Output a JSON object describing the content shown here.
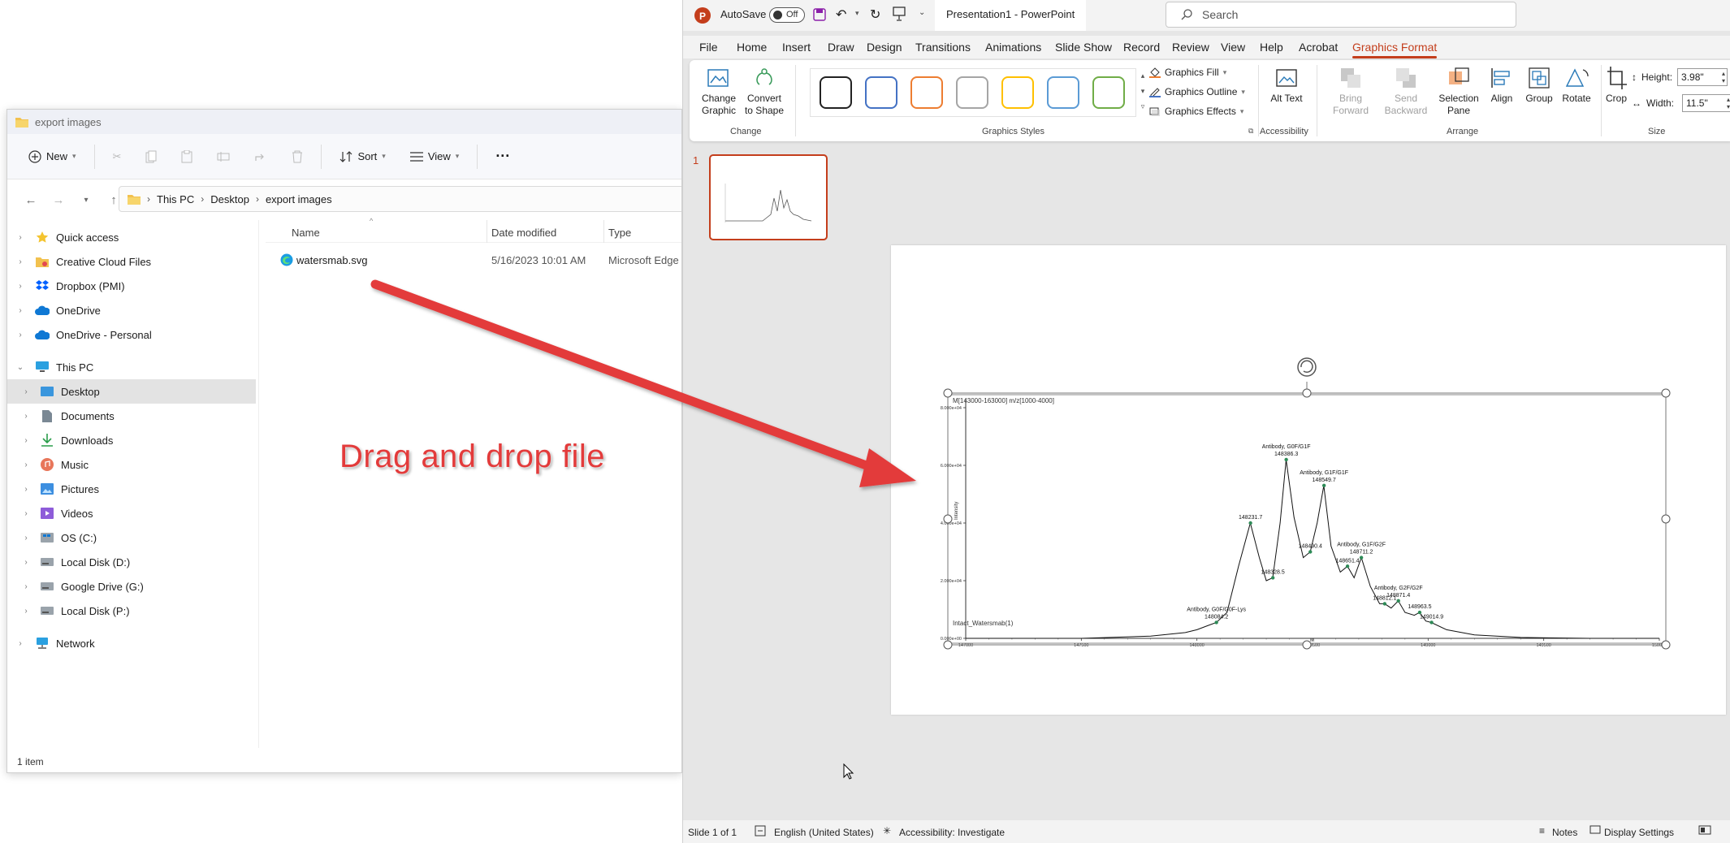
{
  "explorer": {
    "title": "export images",
    "toolbar": {
      "new_label": "New",
      "sort_label": "Sort",
      "view_label": "View",
      "more_label": "···"
    },
    "breadcrumb": [
      "This PC",
      "Desktop",
      "export images"
    ],
    "nav": [
      {
        "label": "Quick access"
      },
      {
        "label": "Creative Cloud Files"
      },
      {
        "label": "Dropbox (PMI)"
      },
      {
        "label": "OneDrive"
      },
      {
        "label": "OneDrive - Personal"
      },
      {
        "label": "This PC"
      },
      {
        "label": "Desktop"
      },
      {
        "label": "Documents"
      },
      {
        "label": "Downloads"
      },
      {
        "label": "Music"
      },
      {
        "label": "Pictures"
      },
      {
        "label": "Videos"
      },
      {
        "label": "OS (C:)"
      },
      {
        "label": "Local Disk (D:)"
      },
      {
        "label": "Google Drive (G:)"
      },
      {
        "label": "Local Disk (P:)"
      },
      {
        "label": "Network"
      }
    ],
    "columns": {
      "name": "Name",
      "date": "Date modified",
      "type": "Type"
    },
    "files": [
      {
        "name": "watersmab.svg",
        "date": "5/16/2023 10:01 AM",
        "type": "Microsoft Edge H..."
      }
    ],
    "status": "1 item"
  },
  "annotation": {
    "text": "Drag and drop file"
  },
  "ppt": {
    "autosave_label": "AutoSave",
    "autosave_state": "Off",
    "doc_title": "Presentation1 - PowerPoint",
    "search_placeholder": "Search",
    "tabs": [
      "File",
      "Home",
      "Insert",
      "Draw",
      "Design",
      "Transitions",
      "Animations",
      "Slide Show",
      "Record",
      "Review",
      "View",
      "Help",
      "Acrobat",
      "Graphics Format"
    ],
    "ribbon": {
      "change_graphic": "Change Graphic",
      "convert_to_shape": "Convert to Shape",
      "group_change": "Change",
      "graphics_fill": "Graphics Fill",
      "graphics_outline": "Graphics Outline",
      "graphics_effects": "Graphics Effects",
      "group_graphics_styles": "Graphics Styles",
      "alt_text": "Alt Text",
      "group_accessibility": "Accessibility",
      "bring_forward": "Bring Forward",
      "send_backward": "Send Backward",
      "selection_pane": "Selection Pane",
      "align": "Align",
      "group": "Group",
      "rotate": "Rotate",
      "group_arrange": "Arrange",
      "crop": "Crop",
      "height_label": "Height:",
      "height_value": "3.98\"",
      "width_label": "Width:",
      "width_value": "11.5\"",
      "group_size": "Size",
      "swatch_colors": [
        "#222222",
        "#4472c4",
        "#ed7d31",
        "#a5a5a5",
        "#ffc000",
        "#5b9bd5",
        "#70ad47"
      ]
    },
    "slide_number": "1",
    "status": {
      "slide": "Slide 1 of 1",
      "language": "English (United States)",
      "accessibility": "Accessibility: Investigate",
      "notes": "Notes",
      "display_settings": "Display Settings"
    }
  },
  "spectrum": {
    "header": "M[143000-163000] m/z[1000-4000]",
    "trace_label": "Intact_Watersmab(1)",
    "y_axis_label": "Intensity",
    "x_axis_label": "M",
    "y_ticks": [
      "0.000e+00",
      "2.000e+04",
      "4.000e+04",
      "6.000e+04",
      "8.000e+04"
    ],
    "x_ticks": [
      "147000",
      "147500",
      "148000",
      "148500",
      "149000",
      "149500",
      "150000"
    ],
    "peaks": [
      {
        "label": "Antibody, G0F/G0F-Lys",
        "mass": "148084.2"
      },
      {
        "label": "",
        "mass": "148231.7"
      },
      {
        "label": "",
        "mass": "148328.5"
      },
      {
        "label": "Antibody, G0F/G1F",
        "mass": "148386.3"
      },
      {
        "label": "",
        "mass": "148490.4"
      },
      {
        "label": "Antibody, G1F/G1F",
        "mass": "148549.7"
      },
      {
        "label": "",
        "mass": "148651.4"
      },
      {
        "label": "Antibody, G1F/G2F",
        "mass": "148711.2"
      },
      {
        "label": "",
        "mass": "148812.1"
      },
      {
        "label": "Antibody, G2F/G2F",
        "mass": "148871.4"
      },
      {
        "label": "",
        "mass": "148963.5"
      },
      {
        "label": "",
        "mass": "149014.9"
      }
    ]
  },
  "chart_data": {
    "type": "line",
    "title": "M[143000-163000] m/z[1000-4000]",
    "xlabel": "M",
    "ylabel": "Intensity",
    "xlim": [
      147000,
      150000
    ],
    "ylim": [
      0,
      80000
    ],
    "series": [
      {
        "name": "Intact_Watersmab(1)",
        "x": [
          147000,
          147500,
          147800,
          147950,
          148000,
          148050,
          148084,
          148130,
          148180,
          148231,
          148270,
          148300,
          148328,
          148360,
          148386,
          148420,
          148460,
          148490,
          148520,
          148549,
          148580,
          148620,
          148651,
          148680,
          148711,
          148750,
          148790,
          148812,
          148840,
          148871,
          148900,
          148940,
          148963,
          148990,
          149014,
          149080,
          149200,
          149400,
          149700,
          150000
        ],
        "y": [
          0,
          0,
          800,
          2000,
          3000,
          4500,
          5500,
          9000,
          25000,
          40000,
          28000,
          20000,
          21000,
          40000,
          62000,
          42000,
          28000,
          30000,
          40000,
          53000,
          32000,
          23000,
          25000,
          21000,
          28000,
          18000,
          12000,
          12000,
          10500,
          13000,
          9000,
          8000,
          9000,
          6000,
          5500,
          3000,
          1200,
          300,
          0,
          0
        ]
      }
    ],
    "peak_labels": [
      {
        "x": 148084.2,
        "y": 5500,
        "text": "Antibody, G0F/G0F-Lys 148084.2"
      },
      {
        "x": 148231.7,
        "y": 40000,
        "text": "148231.7"
      },
      {
        "x": 148328.5,
        "y": 21000,
        "text": "148328.5"
      },
      {
        "x": 148386.3,
        "y": 62000,
        "text": "Antibody, G0F/G1F 148386.3"
      },
      {
        "x": 148490.4,
        "y": 30000,
        "text": "148490.4"
      },
      {
        "x": 148549.7,
        "y": 53000,
        "text": "Antibody, G1F/G1F 148549.7"
      },
      {
        "x": 148651.4,
        "y": 25000,
        "text": "148651.4"
      },
      {
        "x": 148711.2,
        "y": 28000,
        "text": "Antibody, G1F/G2F 148711.2"
      },
      {
        "x": 148812.1,
        "y": 12000,
        "text": "148812.1"
      },
      {
        "x": 148871.4,
        "y": 13000,
        "text": "Antibody, G2F/G2F 148871.4"
      },
      {
        "x": 148963.5,
        "y": 9000,
        "text": "148963.5"
      },
      {
        "x": 149014.9,
        "y": 5500,
        "text": "149014.9"
      }
    ]
  },
  "colors": {
    "accent": "#c43e1c",
    "arrow": "#e33b3b",
    "trace": "#111111",
    "peak_marker": "#2e8b57"
  }
}
